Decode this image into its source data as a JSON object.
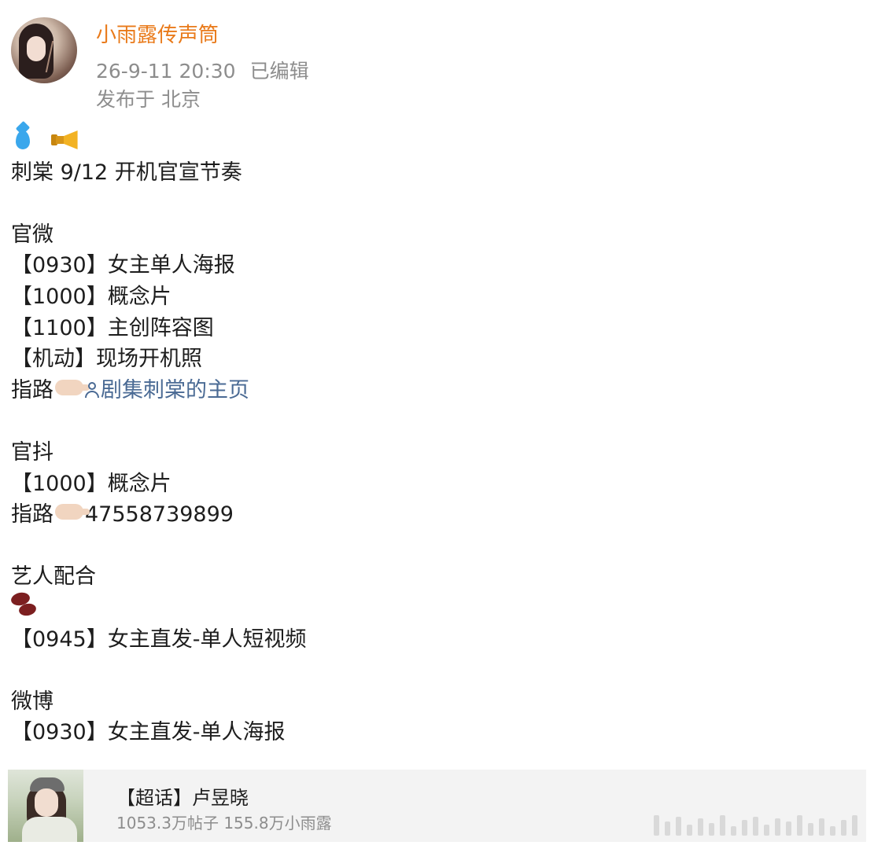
{
  "post": {
    "username": "小雨露传声筒",
    "timestamp": "26-9-11 20:30",
    "edited_label": "已编辑",
    "location": "发布于 北京"
  },
  "content": {
    "line_title": "刺棠 9/12 开机官宣节奏",
    "section1_title": "官微",
    "s1_l1": "【0930】女主单人海报",
    "s1_l2": "【1000】概念片",
    "s1_l3": "【1100】主创阵容图",
    "s1_l4": "【机动】现场开机照",
    "s1_guide_label": "指路",
    "s1_guide_link": "剧集刺棠的主页",
    "section2_title": "官抖",
    "s2_l1": "【1000】概念片",
    "s2_guide_label": "指路",
    "s2_guide_value": "47558739899",
    "section3_title": "艺人配合",
    "s3_l1": "【0945】女主直发-单人短视频",
    "section4_title": "微博",
    "s4_l1": "【0930】女主直发-单人海报"
  },
  "card": {
    "title": "【超话】卢昱晓",
    "stats": "1053.3万帖子 155.8万小雨露"
  },
  "icons": {
    "drop": "water-drop-icon",
    "horn": "megaphone-icon",
    "pointer": "pointing-hand-icon",
    "user": "user-icon",
    "beans": "beans-icon"
  },
  "colors": {
    "username": "#e97a1a",
    "meta": "#8d8d8d",
    "link": "#4a6a94",
    "card_bg": "#f3f3f3"
  }
}
